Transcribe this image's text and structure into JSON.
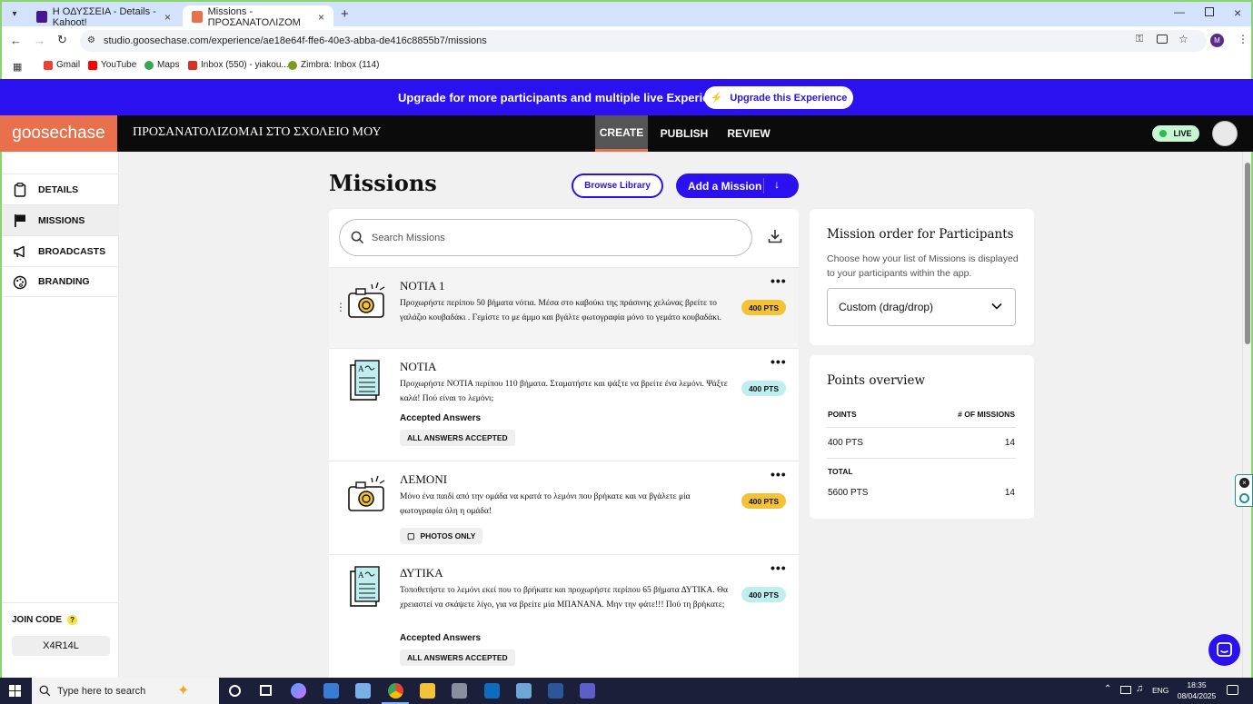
{
  "browser": {
    "tabs": [
      {
        "label": "Η ΟΔΥΣΣΕΙΑ - Details - Kahoot!",
        "favicon": "kahoot-icon"
      },
      {
        "label": "Missions - ΠΡΟΣΑΝΑΤΟΛΙΖΟΜ",
        "favicon": "goosechase-icon"
      }
    ],
    "url": "studio.goosechase.com/experience/ae18e64f-ffe6-40e3-abba-de416c8855b7/missions",
    "profile_initial": "M",
    "bookmarks": [
      {
        "label": "Gmail",
        "color": "#ea4335"
      },
      {
        "label": "YouTube",
        "color": "#ff0000"
      },
      {
        "label": "Maps",
        "color": "#34a853"
      },
      {
        "label": "Inbox (550) - yiakou...",
        "color": "#d93025"
      },
      {
        "label": "Zimbra: Inbox (114)",
        "color": "#7a9a20"
      }
    ]
  },
  "banner": {
    "text": "Upgrade for more participants and multiple live Experiences",
    "button": "Upgrade this Experience",
    "color": "#2c11f0"
  },
  "header": {
    "logo": "goosechase",
    "experience_title": "ΠΡΟΣΑΝΑΤΟΛΙΖΟΜΑΙ ΣΤΟ ΣΧΟΛΕΙΟ ΜΟΥ",
    "tabs": [
      "CREATE",
      "PUBLISH",
      "REVIEW"
    ],
    "active_tab": "CREATE",
    "live_label": "LIVE"
  },
  "sidebar": {
    "items": [
      {
        "label": "DETAILS",
        "icon": "clipboard-icon"
      },
      {
        "label": "MISSIONS",
        "icon": "flag-icon"
      },
      {
        "label": "BROADCASTS",
        "icon": "megaphone-icon"
      },
      {
        "label": "BRANDING",
        "icon": "palette-icon"
      }
    ],
    "active": "MISSIONS",
    "join_code_label": "JOIN CODE",
    "join_code_help": "?",
    "join_code": "X4R14L"
  },
  "main": {
    "title": "Missions",
    "browse_label": "Browse Library",
    "add_label": "Add a Mission",
    "search_placeholder": "Search Missions",
    "missions": [
      {
        "title": "ΝΟΤΙΑ 1",
        "description": "Προχωρήστε περίπου 50 βήματα νότια. Μέσα στο καβούκι της πράσινης χελώνας βρείτε το γαλάζιο κουβαδάκι . Γεμίστε το με άμμο και βγάλτε φωτογραφία μόνο το γεμάτο κουβαδάκι.",
        "points": "400 PTS",
        "type": "camera",
        "subheading": "",
        "tag": ""
      },
      {
        "title": "ΝΟΤΙΑ",
        "description": "Προχωρήστε ΝΟΤΙΑ περίπου 110 βήματα. Σταματήστε και ψάξτε να βρείτε ένα λεμόνι. Ψάξτε καλά! Πού είναι το λεμόνι;",
        "points": "400 PTS",
        "type": "text",
        "subheading": "Accepted Answers",
        "tag": "ALL ANSWERS ACCEPTED"
      },
      {
        "title": "ΛΕΜΟΝΙ",
        "description": "Μόνο ένα παιδί από την ομάδα να κρατά το λεμόνι που βρήκατε και να βγάλετε μία φωτογραφία όλη η ομάδα!",
        "points": "400 PTS",
        "type": "camera",
        "subheading": "",
        "tag": "PHOTOS ONLY"
      },
      {
        "title": "ΔΥΤΙΚΑ",
        "description": "Τοποθετήστε το λεμόνι εκεί που το βρήκατε και προχωρήστε περίπου 65 βήματα ΔΥΤΙΚΑ. Θα χρειαστεί να σκάψετε λίγο, για να βρείτε μία ΜΠΑΝΑΝΑ. Μην την φάτε!!! Πού τη βρήκατε;",
        "points": "400 PTS",
        "type": "text",
        "subheading": "Accepted Answers",
        "tag": "ALL ANSWERS ACCEPTED"
      }
    ]
  },
  "order": {
    "title": "Mission order for Participants",
    "description": "Choose how your list of Missions is displayed to your participants within the app.",
    "selected": "Custom (drag/drop)"
  },
  "points": {
    "title": "Points overview",
    "col_points": "POINTS",
    "col_missions": "# OF MISSIONS",
    "row_points": "400 PTS",
    "row_missions": "14",
    "total_label": "TOTAL",
    "total_points": "5600 PTS",
    "total_missions": "14"
  },
  "taskbar": {
    "search_placeholder": "Type here to search",
    "language": "ENG",
    "time": "18:35",
    "date": "08/04/2025"
  }
}
